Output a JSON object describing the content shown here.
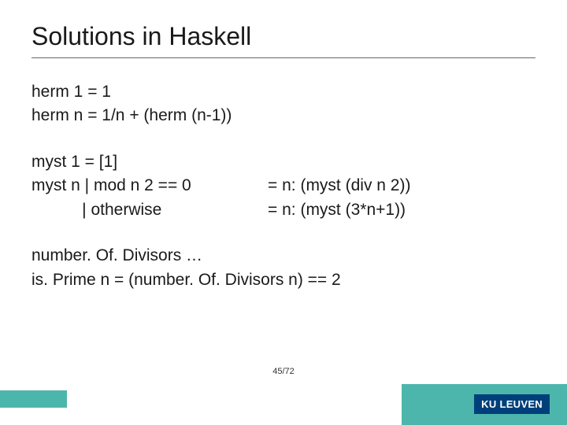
{
  "title": "Solutions in Haskell",
  "block1": {
    "line1": "herm 1 = 1",
    "line2": "herm n = 1/n + (herm (n-1))"
  },
  "block2": {
    "line1": "myst 1 = [1]",
    "row2_left": "myst n | mod n 2 == 0",
    "row2_right": "= n: (myst (div n 2))",
    "row3_left": "           | otherwise",
    "row3_right": "= n: (myst (3*n+1))"
  },
  "block3": {
    "line1": "number. Of. Divisors …",
    "line2": "is. Prime n = (number. Of. Divisors n) == 2"
  },
  "page": "45/72",
  "logo": "KU LEUVEN"
}
